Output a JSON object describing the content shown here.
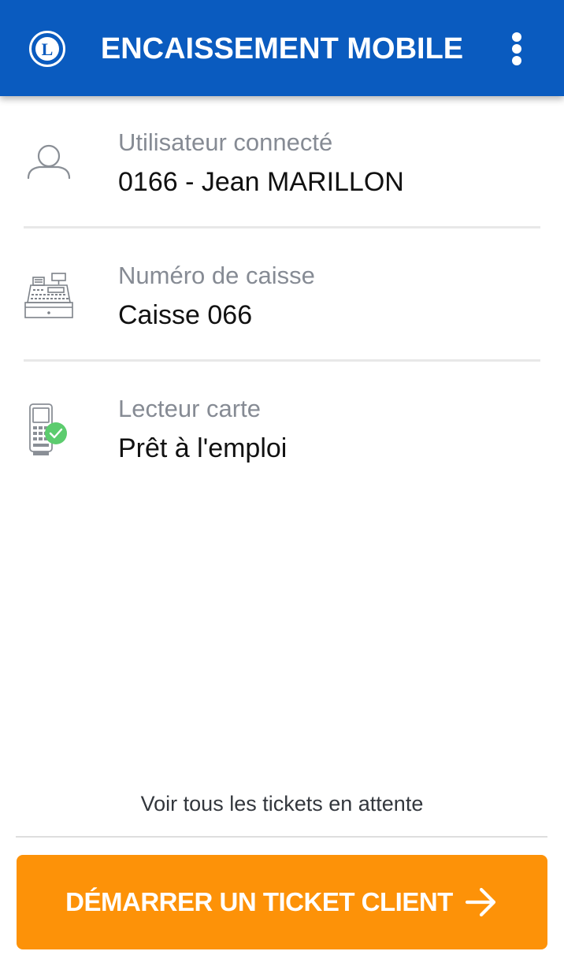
{
  "header": {
    "title": "ENCAISSEMENT MOBILE",
    "logo_letter": "L"
  },
  "info_rows": [
    {
      "label": "Utilisateur connecté",
      "value": "0166 - Jean MARILLON",
      "icon": "user-icon"
    },
    {
      "label": "Numéro de caisse",
      "value": "Caisse 066",
      "icon": "cash-register-icon"
    },
    {
      "label": "Lecteur carte",
      "value": "Prêt à l'emploi",
      "icon": "card-reader-icon",
      "status": "ready",
      "status_color": "#5ccc6e"
    }
  ],
  "footer": {
    "pending_link": "Voir tous les tickets en attente",
    "start_button": "DÉMARRER UN TICKET CLIENT"
  },
  "colors": {
    "primary": "#0a5bbf",
    "accent": "#fd9208",
    "success": "#5ccc6e"
  }
}
